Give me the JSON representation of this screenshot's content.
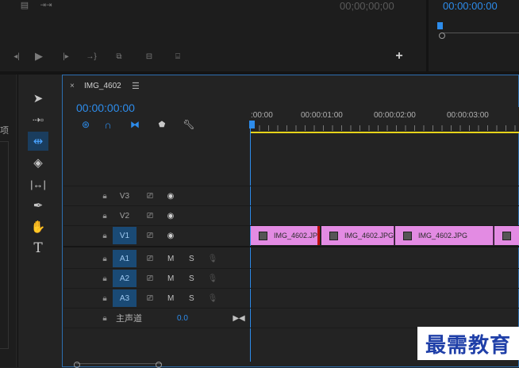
{
  "source_monitor": {
    "timecode": "00;00;00;00"
  },
  "program_monitor": {
    "timecode": "00:00:00:00"
  },
  "sequence": {
    "name": "IMG_4602",
    "timecode": "00:00:00:00",
    "ruler": [
      ":00:00",
      "00:00:01:00",
      "00:00:02:00",
      "00:00:03:00"
    ]
  },
  "left_panel": {
    "fragment": "项"
  },
  "tracks": {
    "video": [
      {
        "name": "V3",
        "target": false
      },
      {
        "name": "V2",
        "target": false
      },
      {
        "name": "V1",
        "target": true
      }
    ],
    "audio": [
      {
        "name": "A1",
        "mute": "M",
        "solo": "S"
      },
      {
        "name": "A2",
        "mute": "M",
        "solo": "S"
      },
      {
        "name": "A3",
        "mute": "M",
        "solo": "S"
      }
    ],
    "master": {
      "name": "主声道",
      "value": "0.0"
    }
  },
  "clips": [
    {
      "label": "IMG_4602.JP"
    },
    {
      "label": "IMG_4602.JPG"
    },
    {
      "label": "IMG_4602.JPG"
    }
  ],
  "watermark": "最需教育",
  "colors": {
    "accent": "#2d8ceb",
    "clip": "#e38be3",
    "playhead": "#2d8ceb",
    "work_area": "#e6d31a"
  }
}
